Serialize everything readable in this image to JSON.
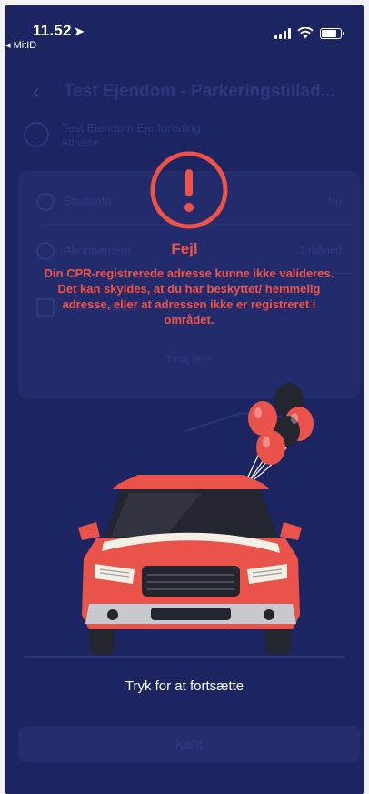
{
  "status_bar": {
    "time": "11.52",
    "back_app": "◂ MitID"
  },
  "background_screen": {
    "title": "Test Ejendom - Parkeringstillad...",
    "property_name": "Test Ejendom Ejerforening",
    "property_sub": "Adresse",
    "rows": [
      {
        "label": "Startdato",
        "value": "Nu"
      },
      {
        "label": "Abonnement",
        "value": "1 måned"
      },
      {
        "label": "Nummerplade",
        "value": ""
      }
    ],
    "link": "Tilføj bil +",
    "bottom_button": "Købt"
  },
  "error": {
    "title": "Fejl",
    "message": "Din CPR-registrerede adresse kunne ikke valideres. Det kan skyldes, at du har beskyttet/ hemmelig adresse, eller at adressen ikke er registreret i området."
  },
  "continue_text": "Tryk for at fortsætte",
  "colors": {
    "overlay": "#1c2462",
    "error_red": "#f05346",
    "car_red": "#e9534a"
  }
}
